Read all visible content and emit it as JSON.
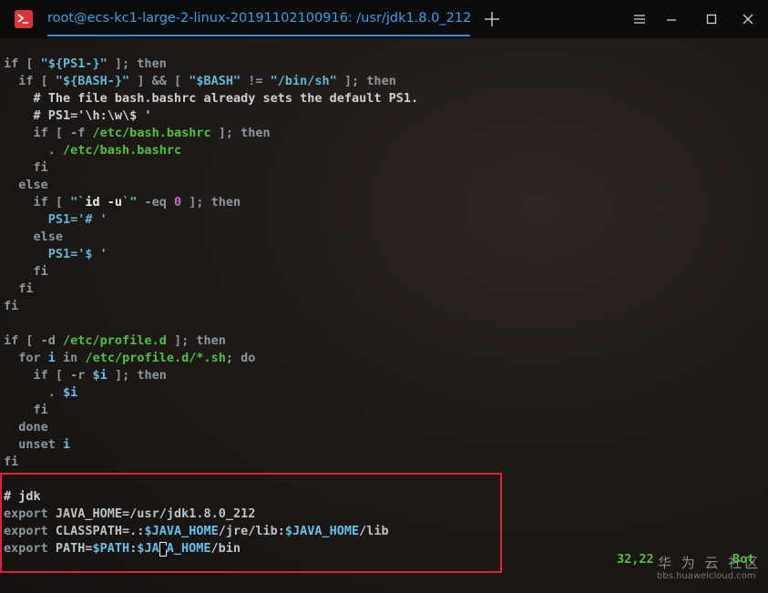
{
  "window": {
    "tab_title": "root@ecs-kc1-large-2-linux-20191102100916: /usr/jdk1.8.0_212"
  },
  "icons": {
    "app": "terminal-icon",
    "new_tab": "plus-icon",
    "menu": "menu-icon",
    "minimize": "minimize-icon",
    "maximize": "maximize-icon",
    "close": "close-icon"
  },
  "terminal": {
    "lines": [
      [
        {
          "t": "if [ ",
          "c": "def"
        },
        {
          "t": "\"${PS1-}\"",
          "c": "str"
        },
        {
          "t": " ]; then",
          "c": "def"
        }
      ],
      [
        {
          "t": "  if [ ",
          "c": "def"
        },
        {
          "t": "\"${BASH-}\"",
          "c": "str"
        },
        {
          "t": " ] && [ ",
          "c": "def"
        },
        {
          "t": "\"$BASH\"",
          "c": "str"
        },
        {
          "t": " != ",
          "c": "def"
        },
        {
          "t": "\"/bin/sh\"",
          "c": "str"
        },
        {
          "t": " ]; then",
          "c": "def"
        }
      ],
      [
        {
          "t": "    # The file bash.bashrc already sets the default PS1.",
          "c": "cmt"
        }
      ],
      [
        {
          "t": "    # PS1='\\h:\\w\\$ '",
          "c": "cmt"
        }
      ],
      [
        {
          "t": "    if [ -f ",
          "c": "def"
        },
        {
          "t": "/etc/bash.bashrc",
          "c": "path"
        },
        {
          "t": " ]; then",
          "c": "def"
        }
      ],
      [
        {
          "t": "      . ",
          "c": "def"
        },
        {
          "t": "/etc/bash.bashrc",
          "c": "path"
        }
      ],
      [
        {
          "t": "    fi",
          "c": "def"
        }
      ],
      [
        {
          "t": "  else",
          "c": "def"
        }
      ],
      [
        {
          "t": "    if [ ",
          "c": "def"
        },
        {
          "t": "\"`",
          "c": "str"
        },
        {
          "t": "id -u",
          "c": "wht"
        },
        {
          "t": "`\"",
          "c": "str"
        },
        {
          "t": " -eq ",
          "c": "def"
        },
        {
          "t": "0",
          "c": "num"
        },
        {
          "t": " ]; then",
          "c": "def"
        }
      ],
      [
        {
          "t": "      PS1=",
          "c": "str"
        },
        {
          "t": "'# '",
          "c": "str"
        }
      ],
      [
        {
          "t": "    else",
          "c": "def"
        }
      ],
      [
        {
          "t": "      PS1=",
          "c": "str"
        },
        {
          "t": "'$ '",
          "c": "str"
        }
      ],
      [
        {
          "t": "    fi",
          "c": "def"
        }
      ],
      [
        {
          "t": "  fi",
          "c": "def"
        }
      ],
      [
        {
          "t": "fi",
          "c": "def"
        }
      ],
      [],
      [
        {
          "t": "if [ -d ",
          "c": "def"
        },
        {
          "t": "/etc/profile.d",
          "c": "path"
        },
        {
          "t": " ]; then",
          "c": "def"
        }
      ],
      [
        {
          "t": "  for ",
          "c": "def"
        },
        {
          "t": "i",
          "c": "var"
        },
        {
          "t": " in ",
          "c": "def"
        },
        {
          "t": "/etc/profile.d/*.sh",
          "c": "path"
        },
        {
          "t": "; do",
          "c": "def"
        }
      ],
      [
        {
          "t": "    if [ -r ",
          "c": "def"
        },
        {
          "t": "$i",
          "c": "var"
        },
        {
          "t": " ]; then",
          "c": "def"
        }
      ],
      [
        {
          "t": "      . ",
          "c": "def"
        },
        {
          "t": "$i",
          "c": "var"
        }
      ],
      [
        {
          "t": "    fi",
          "c": "def"
        }
      ],
      [
        {
          "t": "  done",
          "c": "def"
        }
      ],
      [
        {
          "t": "  unset ",
          "c": "def"
        },
        {
          "t": "i",
          "c": "var"
        }
      ],
      [
        {
          "t": "fi",
          "c": "def"
        }
      ],
      [],
      [
        {
          "t": "# jdk",
          "c": "cmt"
        }
      ],
      [
        {
          "t": "export ",
          "c": "def"
        },
        {
          "t": "JAVA_HOME=/usr/jdk1.8.0_212",
          "c": "txt"
        }
      ],
      [
        {
          "t": "export ",
          "c": "def"
        },
        {
          "t": "CLASSPATH=.:",
          "c": "txt"
        },
        {
          "t": "$JAVA_HOME",
          "c": "var"
        },
        {
          "t": "/jre/lib:",
          "c": "txt"
        },
        {
          "t": "$JAVA_HOME",
          "c": "var"
        },
        {
          "t": "/lib",
          "c": "txt"
        }
      ],
      [
        {
          "t": "export ",
          "c": "def"
        },
        {
          "t": "PATH=",
          "c": "txt"
        },
        {
          "t": "$PATH",
          "c": "var"
        },
        {
          "t": ":",
          "c": "txt"
        },
        {
          "t": "$JA",
          "c": "var"
        },
        {
          "t": "V",
          "c": "cursor"
        },
        {
          "t": "A_HOME",
          "c": "var"
        },
        {
          "t": "/bin",
          "c": "txt"
        }
      ]
    ]
  },
  "status": {
    "position": "32,22",
    "scroll": "Bot"
  },
  "watermark": {
    "main": "华 为 云 社区",
    "sub": "bbs.huaweicloud.com"
  },
  "colors": {
    "highlight_border": "#e0213a",
    "tab_accent": "#3aa1e6",
    "path": "#4fc13a",
    "variable": "#62c1ee"
  }
}
